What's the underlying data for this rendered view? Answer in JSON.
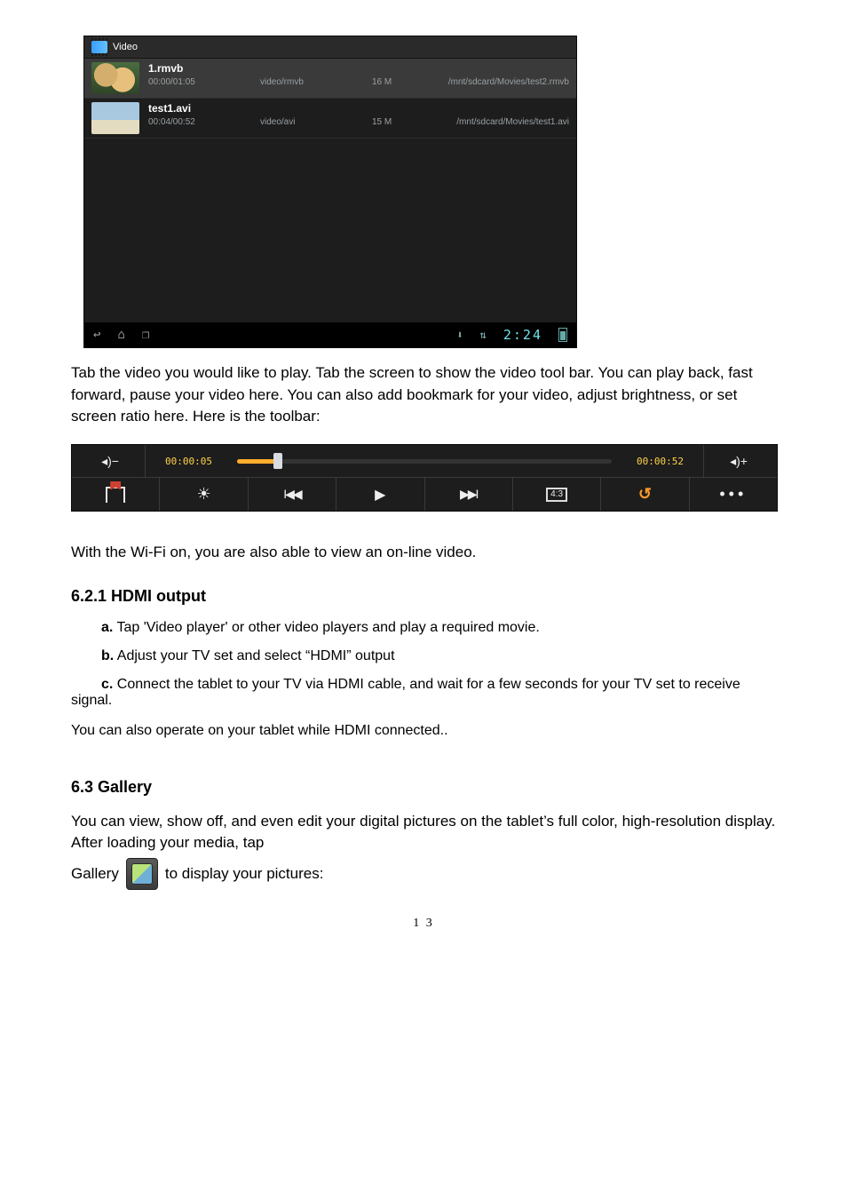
{
  "video_app": {
    "header_title": "Video",
    "rows": [
      {
        "filename": "1.rmvb",
        "duration": "00:00/01:05",
        "codec": "video/rmvb",
        "size": "16 M",
        "path": "/mnt/sdcard/Movies/test2.rmvb"
      },
      {
        "filename": "test1.avi",
        "duration": "00:04/00:52",
        "codec": "video/avi",
        "size": "15 M",
        "path": "/mnt/sdcard/Movies/test1.avi"
      }
    ],
    "clock": "2:24"
  },
  "paragraph1": "Tab the video you would like to play. Tab the screen to show the video tool bar. You can play back, fast forward, pause your video here. You can also add bookmark for your video, adjust brightness, or set screen ratio here. Here is the toolbar:",
  "toolbar": {
    "vol_down": "◂)−",
    "time_current": "00:00:05",
    "time_total": "00:00:52",
    "vol_up": "◂)+",
    "ratio_label": "4:3"
  },
  "paragraph2": "With the Wi-Fi on, you are also able to view an on-line video.",
  "section_hdmi": "6.2.1 HDMI output",
  "steps": {
    "a_label": "a.",
    "a_text": " Tap 'Video player' or other video players and play a required movie.",
    "b_label": "b.",
    "b_text": " Adjust your TV set and select “HDMI” output",
    "c_label": "c.",
    "c_text": " Connect the tablet to your TV via HDMI cable, and wait for a few seconds for your TV set to receive signal."
  },
  "hdmi_note": "You can also operate on your tablet while HDMI connected..",
  "section_gallery": "6.3 Gallery",
  "gallery_text": "You can view, show off, and even edit your digital pictures on the tablet’s full color, high-resolution display. After loading your media, tap",
  "gallery_line_pre": "Gallery",
  "gallery_line_post": " to display your pictures:",
  "page_number": "1 3"
}
